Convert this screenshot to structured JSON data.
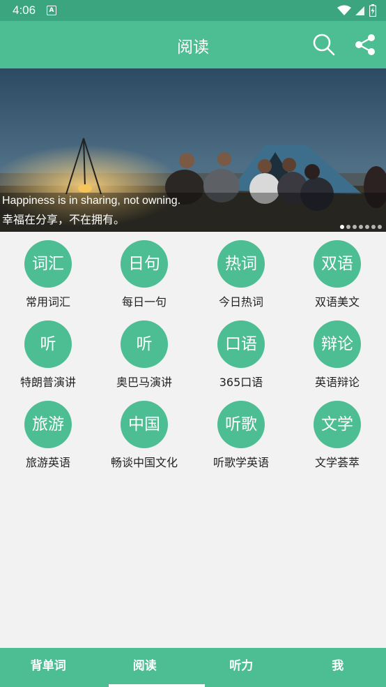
{
  "status": {
    "time": "4:06",
    "a_badge": "A"
  },
  "appbar": {
    "title": "阅读",
    "search_icon": "search-icon",
    "share_icon": "share-icon"
  },
  "banner": {
    "caption_en": "Happiness is in sharing, not owning.",
    "caption_zh": "幸福在分享，不在拥有。",
    "dot_count": 7,
    "active_dot": 0
  },
  "categories": [
    {
      "icon": "词汇",
      "label": "常用词汇"
    },
    {
      "icon": "日句",
      "label": "每日一句"
    },
    {
      "icon": "热词",
      "label": "今日热词"
    },
    {
      "icon": "双语",
      "label": "双语美文"
    },
    {
      "icon": "听",
      "label": "特朗普演讲"
    },
    {
      "icon": "听",
      "label": "奥巴马演讲"
    },
    {
      "icon": "口语",
      "label": "365口语"
    },
    {
      "icon": "辩论",
      "label": "英语辩论"
    },
    {
      "icon": "旅游",
      "label": "旅游英语"
    },
    {
      "icon": "中国",
      "label": "畅谈中国文化"
    },
    {
      "icon": "听歌",
      "label": "听歌学英语"
    },
    {
      "icon": "文学",
      "label": "文学荟萃"
    }
  ],
  "bottom_nav": [
    {
      "label": "背单词"
    },
    {
      "label": "阅读",
      "active": true
    },
    {
      "label": "听力"
    },
    {
      "label": "我"
    }
  ],
  "colors": {
    "primary": "#4dbd94",
    "status_bar": "#3aa57e"
  }
}
